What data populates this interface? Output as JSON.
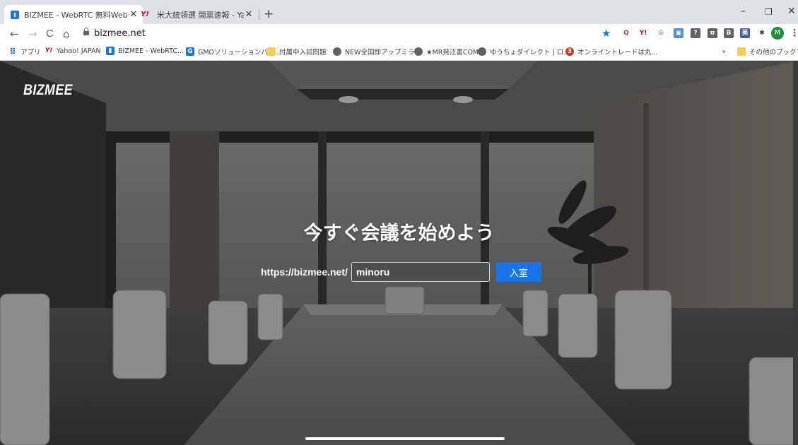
{
  "tabs": [
    {
      "title": "BIZMEE - WebRTC 無料Web会議",
      "close": "✕",
      "favicon": "bizmee-icon",
      "active": true
    },
    {
      "title": "米大統領選 開票速報 - Yahoo!ニ",
      "close": "✕",
      "favicon": "yahoo-icon",
      "active": false
    }
  ],
  "new_tab": "+",
  "window_controls": {
    "minimize": "–",
    "maximize": "❐",
    "close": "✕"
  },
  "toolbar": {
    "back": "←",
    "forward": "→",
    "reload": "C",
    "home": "⌂",
    "url": "bizmee.net",
    "bookmark_star": "★",
    "profile_initial": "M",
    "menu": "⋮",
    "extensions": [
      {
        "name": "search-extension",
        "glyph": "Q",
        "color": "#d93025"
      },
      {
        "name": "yahoo-extension",
        "glyph": "Y!",
        "color": "#d6002a"
      },
      {
        "name": "github-extension",
        "glyph": "◎",
        "color": "#5f6368"
      },
      {
        "name": "screen-extension",
        "glyph": "▣",
        "color": "#4f8fd6"
      },
      {
        "name": "help-extension",
        "glyph": "?",
        "color": "#5f6368"
      },
      {
        "name": "pocket-extension",
        "glyph": "ʊ",
        "color": "#5f6368"
      },
      {
        "name": "hatena-extension",
        "glyph": "B",
        "color": "#5f6368"
      },
      {
        "name": "dictionary-extension",
        "glyph": "英",
        "color": "#3b5fa0"
      },
      {
        "name": "puzzle-extension",
        "glyph": "✱",
        "color": "#3c4043"
      }
    ]
  },
  "bookmarks": [
    {
      "label": "アプリ",
      "icon": "apps-icon"
    },
    {
      "label": "Yahoo! JAPAN",
      "icon": "yahoo-icon"
    },
    {
      "label": "BIZMEE - WebRTC...",
      "icon": "bizmee-icon"
    },
    {
      "label": "GMOソリューションパー...",
      "icon": "gmo-icon"
    },
    {
      "label": "付属中入試問題",
      "icon": "folder-icon"
    },
    {
      "label": "NEW全国即アップミラ...",
      "icon": "globe-icon"
    },
    {
      "label": "★MR発注書COMP",
      "icon": "globe-icon"
    },
    {
      "label": "ゆうちょダイレクト | ロ...",
      "icon": "globe-icon"
    },
    {
      "label": "オンライントレードは丸...",
      "icon": "trade-icon"
    }
  ],
  "bookmarks_overflow": "»",
  "other_bookmarks": "その他のブックマーク",
  "hero": {
    "logo": "BIZMEE",
    "headline": "今すぐ会議を始めよう",
    "url_prefix": "https://bizmee.net/",
    "room_value": "minoru",
    "enter_button": "入室"
  }
}
